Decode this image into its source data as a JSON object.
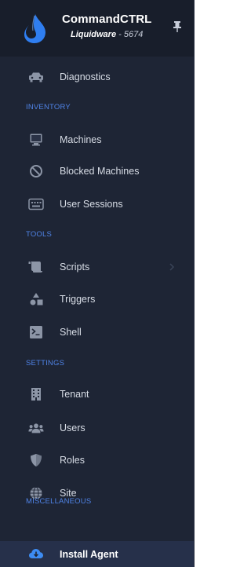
{
  "header": {
    "app_title": "CommandCTRL",
    "tenant_name": "Liquidware",
    "tenant_separator": " - ",
    "tenant_id": "5674"
  },
  "nav": {
    "diagnostics": "Diagnostics",
    "inventory_section": "INVENTORY",
    "machines": "Machines",
    "blocked_machines": "Blocked Machines",
    "user_sessions": "User Sessions",
    "tools_section": "TOOLS",
    "scripts": "Scripts",
    "triggers": "Triggers",
    "shell": "Shell",
    "settings_section": "SETTINGS",
    "tenant": "Tenant",
    "users": "Users",
    "roles": "Roles",
    "site": "Site",
    "misc_section": "MISCELLANEOUS",
    "install_agent": "Install Agent"
  },
  "colors": {
    "sidebar_bg": "#1e2535",
    "section_header": "#4f83e6",
    "active_bg": "#26304a",
    "logo_blue": "#2f7ef0"
  },
  "icons": {
    "logo": "liquid-drop-logo",
    "pin": "pin-icon",
    "diagnostics": "car-icon",
    "machines": "desktop-icon",
    "blocked_machines": "ban-icon",
    "user_sessions": "keyboard-icon",
    "scripts": "scroll-icon",
    "scripts_expand": "chevron-right-icon",
    "triggers": "shapes-icon",
    "shell": "terminal-icon",
    "tenant": "building-icon",
    "users": "users-icon",
    "roles": "shield-icon",
    "site": "globe-icon",
    "install_agent": "cloud-download-icon"
  },
  "state": {
    "active_item": "Install Agent"
  }
}
